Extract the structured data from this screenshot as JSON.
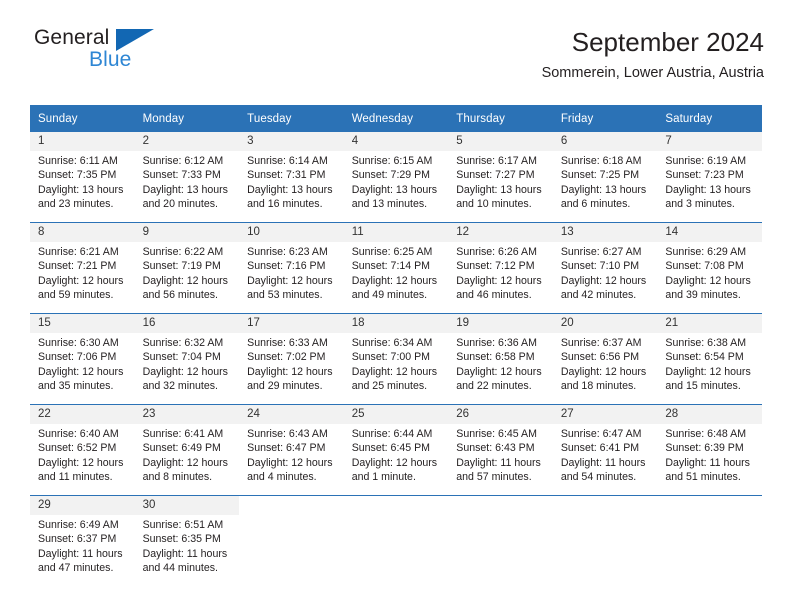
{
  "brand": {
    "name_top": "General",
    "name_bottom": "Blue",
    "triangle_color": "#1267b3",
    "blue_text_color": "#2e86d4",
    "logo_icon": "general-blue-logo"
  },
  "header": {
    "title": "September 2024",
    "subtitle": "Sommerein, Lower Austria, Austria"
  },
  "theme": {
    "header_bg": "#2b72b6",
    "header_text": "#ffffff",
    "daynum_bg": "#f2f2f2",
    "body_text": "#231f20",
    "row_divider": "#2b72b6"
  },
  "calendar": {
    "weekday_headers": [
      "Sunday",
      "Monday",
      "Tuesday",
      "Wednesday",
      "Thursday",
      "Friday",
      "Saturday"
    ],
    "weeks": [
      [
        {
          "day": "1",
          "sunrise": "Sunrise: 6:11 AM",
          "sunset": "Sunset: 7:35 PM",
          "daylight_1": "Daylight: 13 hours",
          "daylight_2": "and 23 minutes."
        },
        {
          "day": "2",
          "sunrise": "Sunrise: 6:12 AM",
          "sunset": "Sunset: 7:33 PM",
          "daylight_1": "Daylight: 13 hours",
          "daylight_2": "and 20 minutes."
        },
        {
          "day": "3",
          "sunrise": "Sunrise: 6:14 AM",
          "sunset": "Sunset: 7:31 PM",
          "daylight_1": "Daylight: 13 hours",
          "daylight_2": "and 16 minutes."
        },
        {
          "day": "4",
          "sunrise": "Sunrise: 6:15 AM",
          "sunset": "Sunset: 7:29 PM",
          "daylight_1": "Daylight: 13 hours",
          "daylight_2": "and 13 minutes."
        },
        {
          "day": "5",
          "sunrise": "Sunrise: 6:17 AM",
          "sunset": "Sunset: 7:27 PM",
          "daylight_1": "Daylight: 13 hours",
          "daylight_2": "and 10 minutes."
        },
        {
          "day": "6",
          "sunrise": "Sunrise: 6:18 AM",
          "sunset": "Sunset: 7:25 PM",
          "daylight_1": "Daylight: 13 hours",
          "daylight_2": "and 6 minutes."
        },
        {
          "day": "7",
          "sunrise": "Sunrise: 6:19 AM",
          "sunset": "Sunset: 7:23 PM",
          "daylight_1": "Daylight: 13 hours",
          "daylight_2": "and 3 minutes."
        }
      ],
      [
        {
          "day": "8",
          "sunrise": "Sunrise: 6:21 AM",
          "sunset": "Sunset: 7:21 PM",
          "daylight_1": "Daylight: 12 hours",
          "daylight_2": "and 59 minutes."
        },
        {
          "day": "9",
          "sunrise": "Sunrise: 6:22 AM",
          "sunset": "Sunset: 7:19 PM",
          "daylight_1": "Daylight: 12 hours",
          "daylight_2": "and 56 minutes."
        },
        {
          "day": "10",
          "sunrise": "Sunrise: 6:23 AM",
          "sunset": "Sunset: 7:16 PM",
          "daylight_1": "Daylight: 12 hours",
          "daylight_2": "and 53 minutes."
        },
        {
          "day": "11",
          "sunrise": "Sunrise: 6:25 AM",
          "sunset": "Sunset: 7:14 PM",
          "daylight_1": "Daylight: 12 hours",
          "daylight_2": "and 49 minutes."
        },
        {
          "day": "12",
          "sunrise": "Sunrise: 6:26 AM",
          "sunset": "Sunset: 7:12 PM",
          "daylight_1": "Daylight: 12 hours",
          "daylight_2": "and 46 minutes."
        },
        {
          "day": "13",
          "sunrise": "Sunrise: 6:27 AM",
          "sunset": "Sunset: 7:10 PM",
          "daylight_1": "Daylight: 12 hours",
          "daylight_2": "and 42 minutes."
        },
        {
          "day": "14",
          "sunrise": "Sunrise: 6:29 AM",
          "sunset": "Sunset: 7:08 PM",
          "daylight_1": "Daylight: 12 hours",
          "daylight_2": "and 39 minutes."
        }
      ],
      [
        {
          "day": "15",
          "sunrise": "Sunrise: 6:30 AM",
          "sunset": "Sunset: 7:06 PM",
          "daylight_1": "Daylight: 12 hours",
          "daylight_2": "and 35 minutes."
        },
        {
          "day": "16",
          "sunrise": "Sunrise: 6:32 AM",
          "sunset": "Sunset: 7:04 PM",
          "daylight_1": "Daylight: 12 hours",
          "daylight_2": "and 32 minutes."
        },
        {
          "day": "17",
          "sunrise": "Sunrise: 6:33 AM",
          "sunset": "Sunset: 7:02 PM",
          "daylight_1": "Daylight: 12 hours",
          "daylight_2": "and 29 minutes."
        },
        {
          "day": "18",
          "sunrise": "Sunrise: 6:34 AM",
          "sunset": "Sunset: 7:00 PM",
          "daylight_1": "Daylight: 12 hours",
          "daylight_2": "and 25 minutes."
        },
        {
          "day": "19",
          "sunrise": "Sunrise: 6:36 AM",
          "sunset": "Sunset: 6:58 PM",
          "daylight_1": "Daylight: 12 hours",
          "daylight_2": "and 22 minutes."
        },
        {
          "day": "20",
          "sunrise": "Sunrise: 6:37 AM",
          "sunset": "Sunset: 6:56 PM",
          "daylight_1": "Daylight: 12 hours",
          "daylight_2": "and 18 minutes."
        },
        {
          "day": "21",
          "sunrise": "Sunrise: 6:38 AM",
          "sunset": "Sunset: 6:54 PM",
          "daylight_1": "Daylight: 12 hours",
          "daylight_2": "and 15 minutes."
        }
      ],
      [
        {
          "day": "22",
          "sunrise": "Sunrise: 6:40 AM",
          "sunset": "Sunset: 6:52 PM",
          "daylight_1": "Daylight: 12 hours",
          "daylight_2": "and 11 minutes."
        },
        {
          "day": "23",
          "sunrise": "Sunrise: 6:41 AM",
          "sunset": "Sunset: 6:49 PM",
          "daylight_1": "Daylight: 12 hours",
          "daylight_2": "and 8 minutes."
        },
        {
          "day": "24",
          "sunrise": "Sunrise: 6:43 AM",
          "sunset": "Sunset: 6:47 PM",
          "daylight_1": "Daylight: 12 hours",
          "daylight_2": "and 4 minutes."
        },
        {
          "day": "25",
          "sunrise": "Sunrise: 6:44 AM",
          "sunset": "Sunset: 6:45 PM",
          "daylight_1": "Daylight: 12 hours",
          "daylight_2": "and 1 minute."
        },
        {
          "day": "26",
          "sunrise": "Sunrise: 6:45 AM",
          "sunset": "Sunset: 6:43 PM",
          "daylight_1": "Daylight: 11 hours",
          "daylight_2": "and 57 minutes."
        },
        {
          "day": "27",
          "sunrise": "Sunrise: 6:47 AM",
          "sunset": "Sunset: 6:41 PM",
          "daylight_1": "Daylight: 11 hours",
          "daylight_2": "and 54 minutes."
        },
        {
          "day": "28",
          "sunrise": "Sunrise: 6:48 AM",
          "sunset": "Sunset: 6:39 PM",
          "daylight_1": "Daylight: 11 hours",
          "daylight_2": "and 51 minutes."
        }
      ],
      [
        {
          "day": "29",
          "sunrise": "Sunrise: 6:49 AM",
          "sunset": "Sunset: 6:37 PM",
          "daylight_1": "Daylight: 11 hours",
          "daylight_2": "and 47 minutes."
        },
        {
          "day": "30",
          "sunrise": "Sunrise: 6:51 AM",
          "sunset": "Sunset: 6:35 PM",
          "daylight_1": "Daylight: 11 hours",
          "daylight_2": "and 44 minutes."
        },
        {
          "day": "",
          "sunrise": "",
          "sunset": "",
          "daylight_1": "",
          "daylight_2": ""
        },
        {
          "day": "",
          "sunrise": "",
          "sunset": "",
          "daylight_1": "",
          "daylight_2": ""
        },
        {
          "day": "",
          "sunrise": "",
          "sunset": "",
          "daylight_1": "",
          "daylight_2": ""
        },
        {
          "day": "",
          "sunrise": "",
          "sunset": "",
          "daylight_1": "",
          "daylight_2": ""
        },
        {
          "day": "",
          "sunrise": "",
          "sunset": "",
          "daylight_1": "",
          "daylight_2": ""
        }
      ]
    ]
  }
}
